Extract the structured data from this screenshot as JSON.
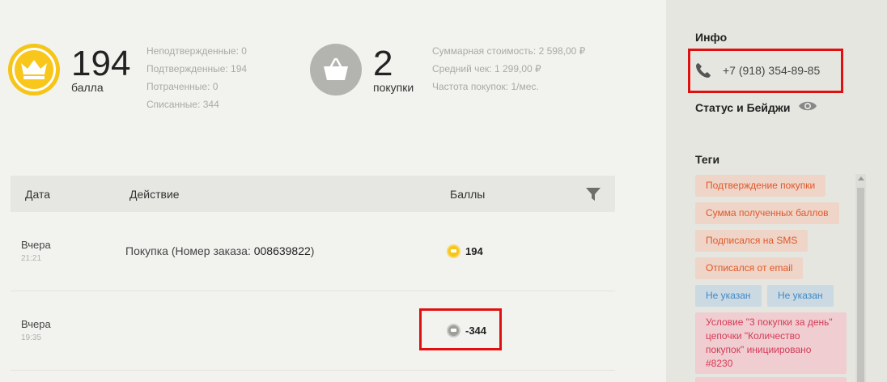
{
  "points": {
    "value": "194",
    "label": "балла",
    "details": [
      "Неподтвержденные: 0",
      "Подтвержденные: 194",
      "Потраченные: 0",
      "Списанные: 344"
    ]
  },
  "purchases": {
    "value": "2",
    "label": "покупки",
    "details": [
      "Суммарная стоимость: 2 598,00 ₽",
      "Средний чек: 1 299,00 ₽",
      "Частота покупок: 1/мес."
    ]
  },
  "table": {
    "headers": {
      "date": "Дата",
      "action": "Действие",
      "points": "Баллы"
    },
    "rows": [
      {
        "date": "Вчера",
        "time": "21:21",
        "action_prefix": "Покупка (Номер заказа: ",
        "order": "008639822",
        "action_suffix": ")",
        "points": "194",
        "coin": "gold"
      },
      {
        "date": "Вчера",
        "time": "19:35",
        "action_prefix": "",
        "order": "",
        "action_suffix": "",
        "points": "-344",
        "coin": "gray"
      }
    ]
  },
  "sidebar": {
    "info_title": "Инфо",
    "phone": "+7 (918) 354-89-85",
    "status_title": "Статус и Бейджи",
    "tags_title": "Теги",
    "tags": [
      {
        "label": "Подтверждение покупки",
        "color": "orange"
      },
      {
        "label": "Сумма полученных баллов",
        "color": "orange"
      },
      {
        "label": "Подписался на SMS",
        "color": "orange"
      },
      {
        "label": "Отписался от email",
        "color": "orange"
      },
      {
        "label": "Не указан",
        "color": "blue"
      },
      {
        "label": "Не указан",
        "color": "blue"
      },
      {
        "label": "Условие \"3 покупки за день\" цепочки \"Количество покупок\" инициировано #8230",
        "color": "pink"
      }
    ]
  },
  "colors": {
    "gold": "#f5c518",
    "highlight": "#e01010",
    "tag_orange_text": "#e0572a",
    "tag_blue_text": "#3f89c4",
    "tag_pink_text": "#d63b57"
  }
}
